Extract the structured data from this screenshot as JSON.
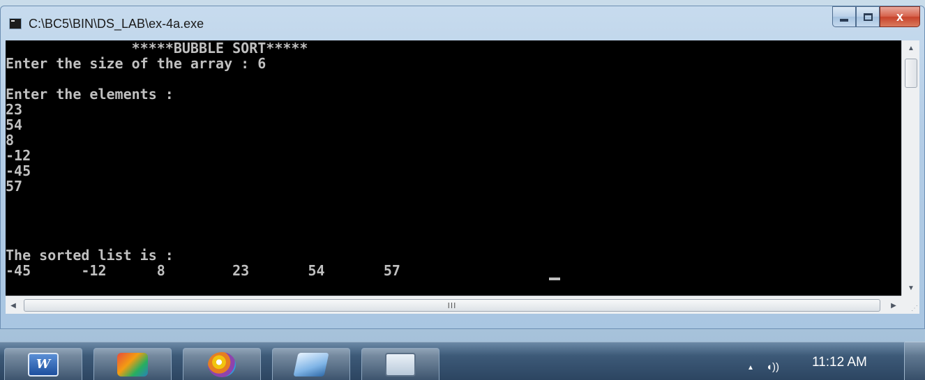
{
  "window": {
    "title": "C:\\BC5\\BIN\\DS_LAB\\ex-4a.exe",
    "caption_buttons": {
      "close_label": "x"
    }
  },
  "console": {
    "lines": [
      "               *****BUBBLE SORT*****",
      "Enter the size of the array : 6",
      "",
      "Enter the elements :",
      "23",
      "54",
      "8",
      "-12",
      "-45",
      "57",
      "",
      "",
      "The sorted list is :",
      "-45      -12      8        23       54       57"
    ],
    "colors": {
      "background": "#000000",
      "text": "#c0c0c0"
    }
  },
  "scrollbars": {
    "horizontal_thumb_grip": "III"
  },
  "taskbar": {
    "buttons": [
      {
        "icon": "word-icon",
        "label": "W"
      },
      {
        "icon": "game-icon"
      },
      {
        "icon": "paint-icon"
      },
      {
        "icon": "notepad-icon"
      },
      {
        "icon": "console-icon"
      }
    ],
    "clock": "11:12 AM"
  }
}
